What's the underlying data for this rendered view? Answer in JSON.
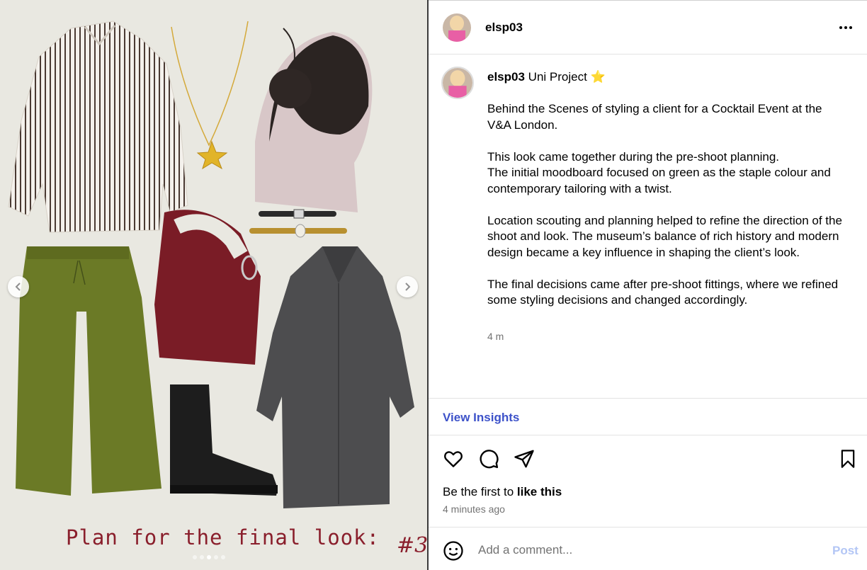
{
  "post": {
    "username": "elsp03",
    "caption_title": "Uni Project",
    "caption_star": "⭐",
    "paragraphs": [
      "Behind the Scenes of styling a client for a Cocktail Event at the V&A London.",
      "This look came together during the pre-shoot planning.\nThe initial moodboard focused on green as the staple colour and contemporary tailoring with a twist.",
      "Location scouting and planning helped to refine the direction of the shoot and look. The museum’s balance of rich history and modern design became a key influence in shaping the client’s look.",
      "The final decisions came after pre-shoot fittings, where we refined some styling decisions and changed accordingly."
    ],
    "caption_time": "4 m",
    "insights_label": "View Insights",
    "like_prefix": "Be the first to ",
    "like_action": "like this",
    "posted_ago": "4 minutes ago",
    "comment_placeholder": "Add a comment...",
    "post_label": "Post"
  },
  "media": {
    "caption_text": "Plan for the final look:",
    "caption_number": "#3",
    "slide_count": 5,
    "active_slide": 3,
    "colors": {
      "background": "#e9e8e1",
      "caption": "#8a1f2c",
      "trousers": "#6b7a26",
      "bag": "#7a1c26",
      "coat": "#4d4d4f",
      "boot": "#1d1d1d"
    }
  },
  "icons": [
    "more-icon",
    "like-heart-icon",
    "comment-icon",
    "share-icon",
    "save-bookmark-icon",
    "emoji-icon",
    "chevron-left-icon",
    "chevron-right-icon"
  ],
  "accent_link_color": "#3d52c9"
}
